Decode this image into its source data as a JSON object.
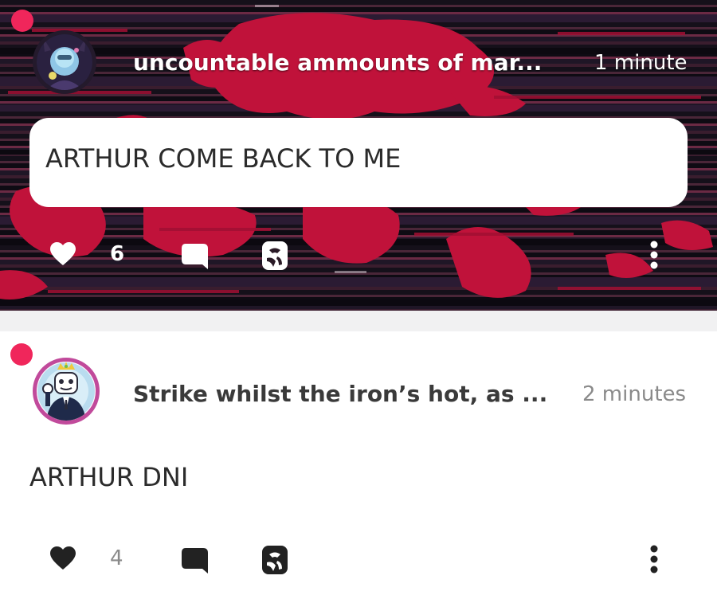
{
  "posts": [
    {
      "author": "uncountable ammounts of mar...",
      "time": "1 minute",
      "message": "ARTHUR COME BACK TO ME",
      "like_count": "6"
    },
    {
      "author": "Strike whilst the iron’s hot, as ...",
      "time": "2 minutes",
      "message": "ARTHUR DNI",
      "like_count": "4"
    }
  ],
  "colors": {
    "unread": "#f0265b",
    "glitch_red": "#c0123a",
    "dark_text": "#2b2b2b",
    "muted_text": "#8a8a8a"
  },
  "icons": [
    "heart-icon",
    "comment-icon",
    "share-icon",
    "more-options-icon"
  ]
}
